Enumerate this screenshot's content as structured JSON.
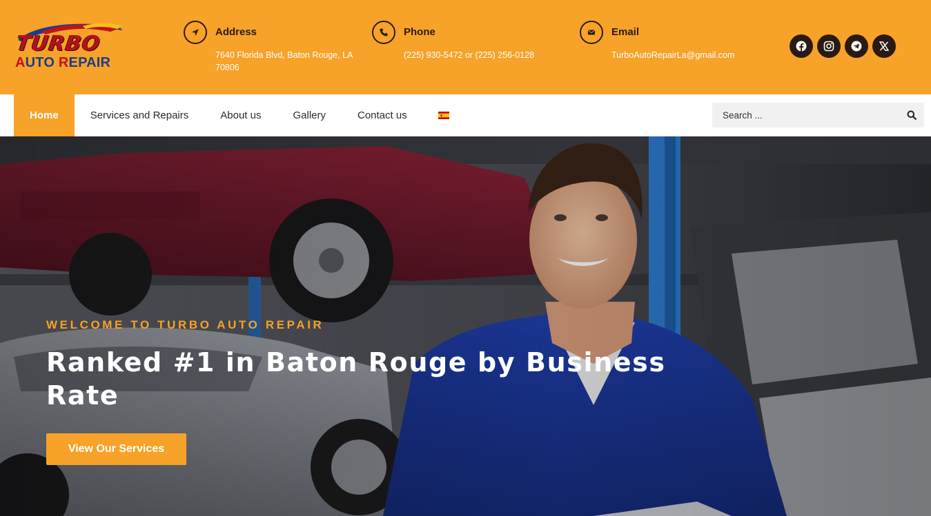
{
  "brand": {
    "logo_word": "TURBO",
    "logo_sub_a": "A",
    "logo_sub_b": "UTO ",
    "logo_sub_c": "R",
    "logo_sub_d": "EPAIR",
    "colors": {
      "orange": "#f7a228",
      "dark": "#2b1a10",
      "logo_red": "#b5121b",
      "logo_blue": "#1c3d8c"
    }
  },
  "contact": {
    "address": {
      "icon": "location-arrow-icon",
      "title": "Address",
      "text": "7640 Florida Blvd, Baton Rouge, LA 70806"
    },
    "phone": {
      "icon": "phone-icon",
      "title": "Phone",
      "text": "(225) 930-5472 or (225) 256-0128"
    },
    "email": {
      "icon": "envelope-icon",
      "title": "Email",
      "text": "TurboAutoRepairLa@gmail.com"
    }
  },
  "socials": [
    {
      "icon": "facebook-icon"
    },
    {
      "icon": "instagram-icon"
    },
    {
      "icon": "telegram-icon"
    },
    {
      "icon": "x-twitter-icon"
    }
  ],
  "nav": {
    "items": [
      {
        "label": "Home",
        "active": true
      },
      {
        "label": "Services and Repairs"
      },
      {
        "label": "About us"
      },
      {
        "label": "Gallery"
      },
      {
        "label": "Contact us"
      }
    ],
    "language_icon": "spain-flag-icon"
  },
  "search": {
    "placeholder": "Search ...",
    "icon": "search-icon"
  },
  "hero": {
    "kicker": "WELCOME TO TURBO AUTO REPAIR",
    "title": "Ranked #1 in Baton Rouge by Business Rate",
    "button_label": "View Our Services"
  }
}
